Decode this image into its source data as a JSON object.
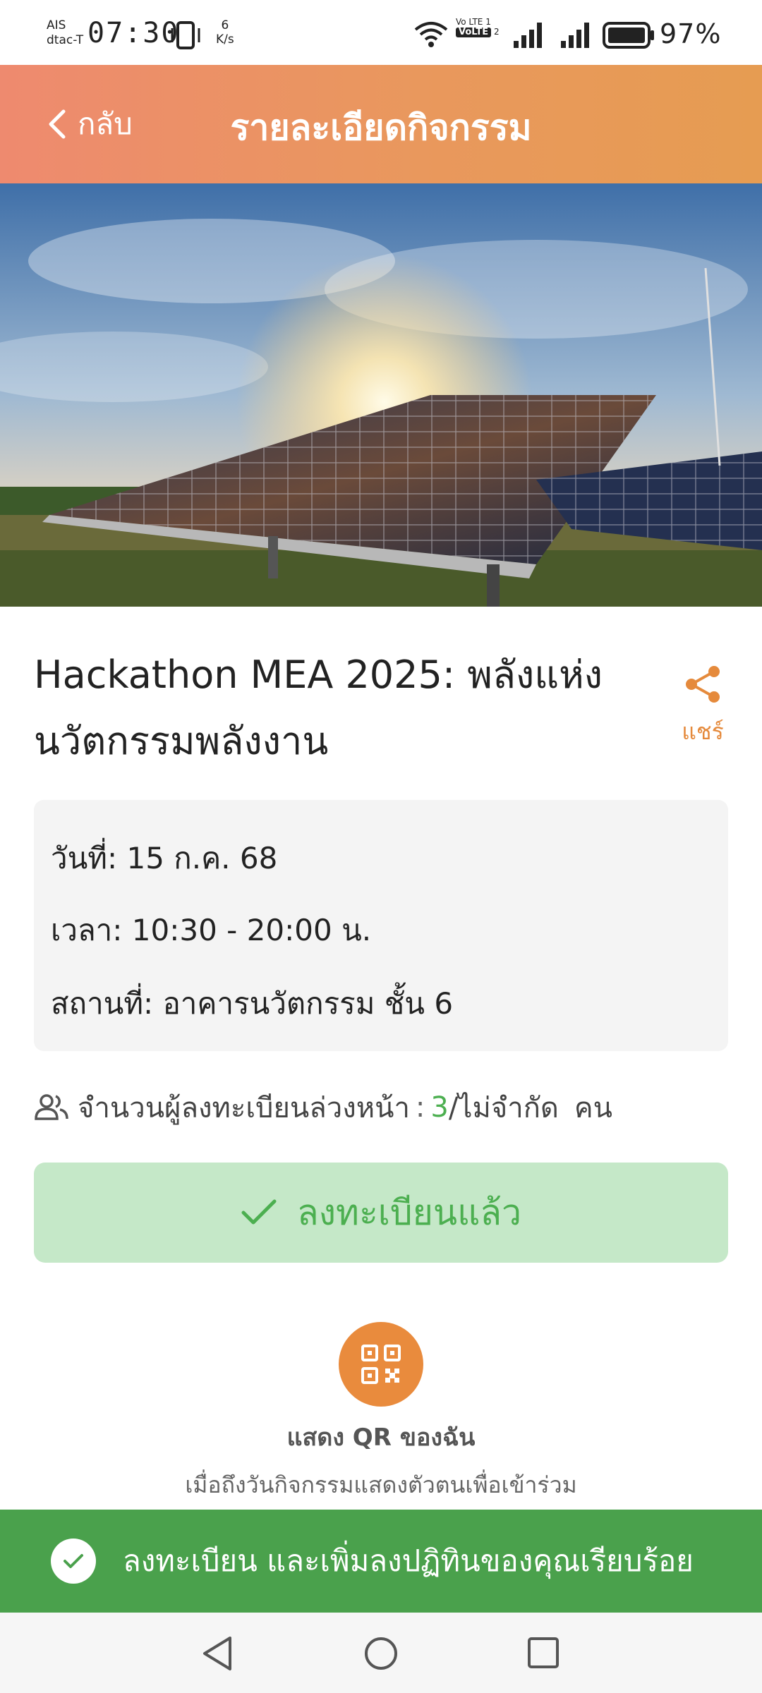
{
  "status_bar": {
    "carrier_1": "AIS",
    "carrier_2": "dtac-T",
    "time": "07:30",
    "speed_value": "6",
    "speed_unit": "K/s",
    "volte_top": "Vo LTE 1",
    "volte_tag": "VoLTE",
    "volte_sim": "2",
    "battery": "97%",
    "icons": [
      "vibrate-icon",
      "wifi-icon",
      "signal-icon",
      "signal-icon",
      "battery-icon"
    ]
  },
  "header": {
    "back_label": "กลับ",
    "title": "รายละเอียดกิจกรรม",
    "gradient_start": "#ee8a6f",
    "gradient_end": "#e69c52"
  },
  "event": {
    "title": "Hackathon MEA 2025: พลังแห่งนวัตกรรมพลังงาน",
    "share_label": "แชร์",
    "date_label": "วันที่:",
    "date_value": "15 ก.ค. 68",
    "time_label": "เวลา:",
    "time_value": "10:30 - 20:00 น.",
    "place_label": "สถานที่:",
    "place_value": "อาคารนวัตกรรม ชั้น 6"
  },
  "attendees": {
    "label": "จำนวนผู้ลงทะเบียนล่วงหน้า",
    "separator": ":",
    "count": "3",
    "limit": "/ไม่จำกัด",
    "unit": "คน"
  },
  "registration": {
    "button_label": "ลงทะเบียนแล้ว",
    "qr_label": "แสดง QR ของฉัน",
    "qr_hint": "เมื่อถึงวันกิจกรรมแสดงตัวตนเพื่อเข้าร่วม"
  },
  "toast": {
    "message": "ลงทะเบียน และเพิ่มลงปฏิทินของคุณเรียบร้อย"
  },
  "colors": {
    "accent": "#e58a3c",
    "success": "#4caf50",
    "success_bg": "#c5e8c8",
    "toast_bg": "#4aa14c"
  }
}
